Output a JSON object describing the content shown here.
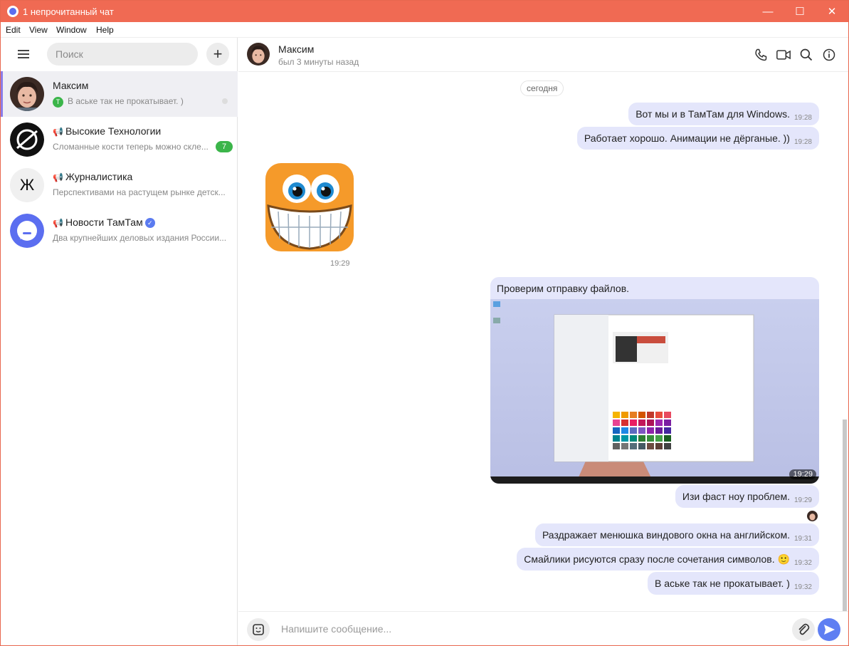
{
  "window": {
    "title": "1 непрочитанный чат",
    "controls": {
      "minimize": "—",
      "maximize": "☐",
      "close": "✕"
    }
  },
  "menu": [
    "Edit",
    "View",
    "Window",
    "Help"
  ],
  "sidebar": {
    "search_placeholder": "Поиск",
    "add_label": "+",
    "chats": [
      {
        "name": "Максим",
        "preview": "В аське так не прокатывает. )",
        "sender_initial": "Т",
        "active": true
      },
      {
        "name": "Высокие Технологии",
        "preview": "Сломанные кости теперь можно скле...",
        "unread": "7",
        "channel": true
      },
      {
        "name": "Журналистика",
        "preview": "Перспективами на растущем рынке детск...",
        "avatar_letter": "Ж",
        "channel": true
      },
      {
        "name": "Новости ТамТам",
        "preview": "Два крупнейших деловых издания России...",
        "channel": true,
        "verified": true
      }
    ]
  },
  "header": {
    "name": "Максим",
    "status": "был 3 минуты назад",
    "icons": [
      "phone-icon",
      "video-icon",
      "search-icon",
      "info-icon"
    ]
  },
  "messages": {
    "date_chip": "сегодня",
    "m1": {
      "text": "Вот мы и в ТамТам для Windows.",
      "time": "19:28"
    },
    "m2": {
      "text": "Работает хорошо. Анимации не дёрганые. ))",
      "time": "19:28"
    },
    "sticker_time": "19:29",
    "file": {
      "caption": "Проверим отправку файлов.",
      "time": "19:29"
    },
    "m3": {
      "text": "Изи фаст ноу проблем.",
      "time": "19:29"
    },
    "m4": {
      "text": "Раздражает менюшка виндового окна на английском.",
      "time": "19:31"
    },
    "m5": {
      "text": "Смайлики рисуются сразу после сочетания символов.",
      "emoji": "🙂",
      "time": "19:32"
    },
    "m6": {
      "text": "В аське так не прокатывает. )",
      "time": "19:32"
    }
  },
  "composer": {
    "placeholder": "Напишите сообщение..."
  },
  "colors": {
    "titlebar": "#f06a53",
    "bubble": "#e4e6fb",
    "accent": "#5e7ef2",
    "badge": "#3bb54a"
  }
}
